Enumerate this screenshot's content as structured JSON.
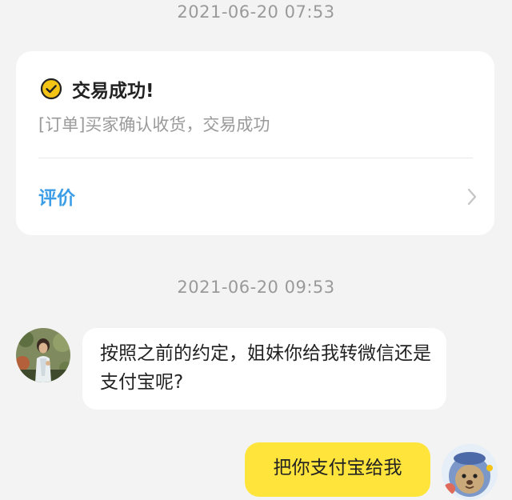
{
  "messages": {
    "timestamp_1": "2021-06-20 07:53",
    "timestamp_2": "2021-06-20 09:53",
    "order_card": {
      "title": "交易成功!",
      "description": "[订单]买家确认收货，交易成功",
      "review_label": "评价",
      "accent_color": "#3d9ee8",
      "check_color": "#f3c316"
    },
    "incoming": {
      "text": "按照之前的约定，姐妹你给我转微信还是支付宝呢?"
    },
    "outgoing": {
      "text": "把你支付宝给我",
      "bubble_color": "#ffe43c"
    }
  },
  "icons": {
    "check": "check-circle-icon",
    "chevron": "chevron-right-icon"
  }
}
